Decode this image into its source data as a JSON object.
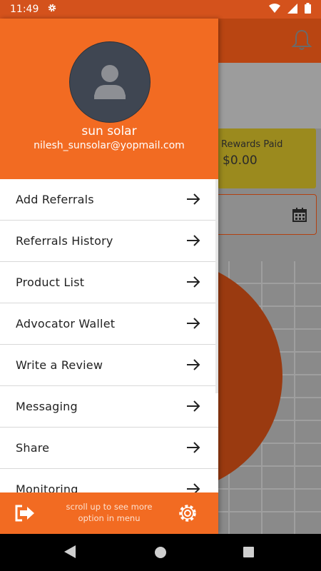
{
  "status_bar": {
    "time": "11:49",
    "icons": [
      "settings-icon",
      "wifi-icon",
      "signal-icon",
      "battery-icon"
    ]
  },
  "background_app": {
    "rewards_label": "Rewards Paid",
    "rewards_value": "$0.00",
    "icons": [
      "bell-icon",
      "calendar-icon"
    ]
  },
  "drawer": {
    "user_name": "sun solar",
    "user_email": "nilesh_sunsolar@yopmail.com",
    "menu": [
      {
        "label": "Add Referrals"
      },
      {
        "label": "Referrals History"
      },
      {
        "label": "Product List"
      },
      {
        "label": "Advocator Wallet"
      },
      {
        "label": "Write a Review"
      },
      {
        "label": "Messaging"
      },
      {
        "label": "Share"
      },
      {
        "label": "Monitoring"
      }
    ],
    "footer_hint": "scroll up to see more option in menu",
    "footer_icons": [
      "logout-icon",
      "settings-icon"
    ]
  },
  "colors": {
    "accent": "#f26b22",
    "status_bar": "#d4521c",
    "rewards_card": "#9b8a1e"
  }
}
